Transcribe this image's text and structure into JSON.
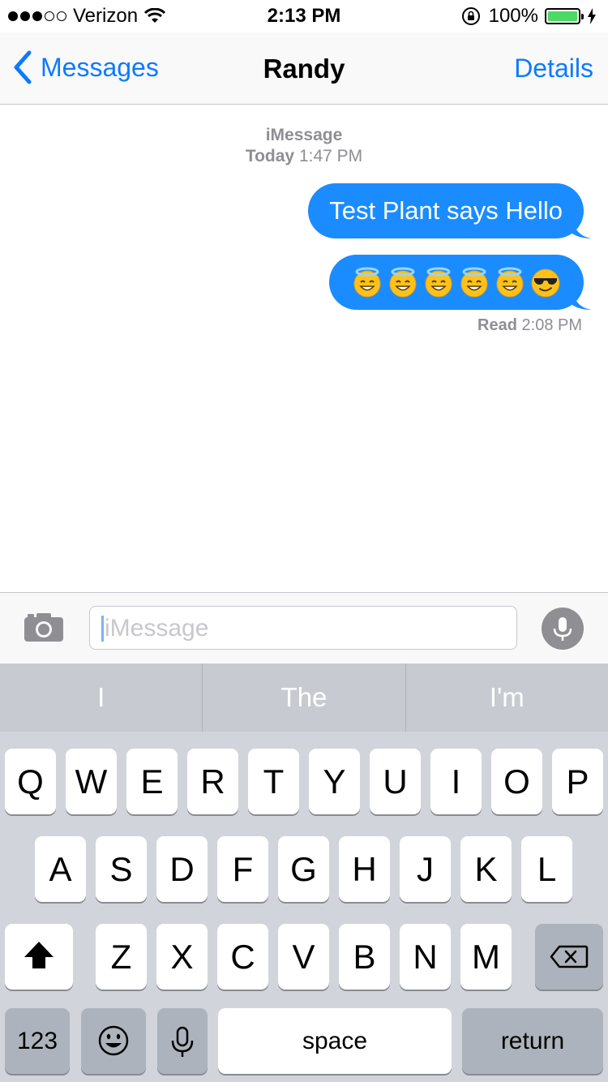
{
  "status_bar": {
    "carrier": "Verizon",
    "time": "2:13 PM",
    "battery_percent": "100%",
    "signal_bars_filled": 3,
    "signal_bars_total": 5
  },
  "nav": {
    "back_label": "Messages",
    "title": "Randy",
    "details_label": "Details"
  },
  "conversation": {
    "service": "iMessage",
    "day": "Today",
    "time": "1:47 PM",
    "messages": [
      {
        "text": "Test Plant says Hello"
      }
    ],
    "emoji_message": [
      "smiling-face-with-halo",
      "smiling-face-with-halo",
      "smiling-face-with-halo",
      "smiling-face-with-halo",
      "smiling-face-with-halo",
      "smiling-face-with-sunglasses"
    ],
    "read_label": "Read",
    "read_time": "2:08 PM",
    "bubble_color": "#1a8cff"
  },
  "input": {
    "placeholder": "iMessage"
  },
  "predictive": [
    "I",
    "The",
    "I'm"
  ],
  "keyboard": {
    "row1": [
      "Q",
      "W",
      "E",
      "R",
      "T",
      "Y",
      "U",
      "I",
      "O",
      "P"
    ],
    "row2": [
      "A",
      "S",
      "D",
      "F",
      "G",
      "H",
      "J",
      "K",
      "L"
    ],
    "row3": [
      "Z",
      "X",
      "C",
      "V",
      "B",
      "N",
      "M"
    ],
    "numbers_label": "123",
    "space_label": "space",
    "return_label": "return"
  },
  "colors": {
    "accent": "#0e7afe",
    "battery": "#4cd964"
  }
}
